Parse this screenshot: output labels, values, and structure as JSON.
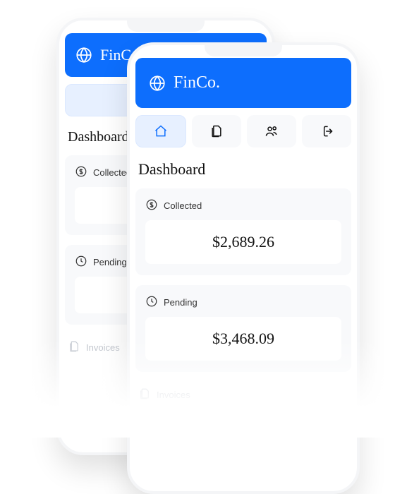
{
  "brand": "FinCo.",
  "page_title": "Dashboard",
  "nav": {
    "items": [
      {
        "name": "home-icon",
        "active": true
      },
      {
        "name": "documents-icon",
        "active": false
      },
      {
        "name": "people-icon",
        "active": false
      },
      {
        "name": "logout-icon",
        "active": false
      }
    ]
  },
  "cards": {
    "collected": {
      "label": "Collected",
      "amount": "$2,689.26"
    },
    "pending": {
      "label": "Pending",
      "amount": "$3,468.09"
    }
  },
  "list": {
    "invoices_label": "Invoices"
  }
}
